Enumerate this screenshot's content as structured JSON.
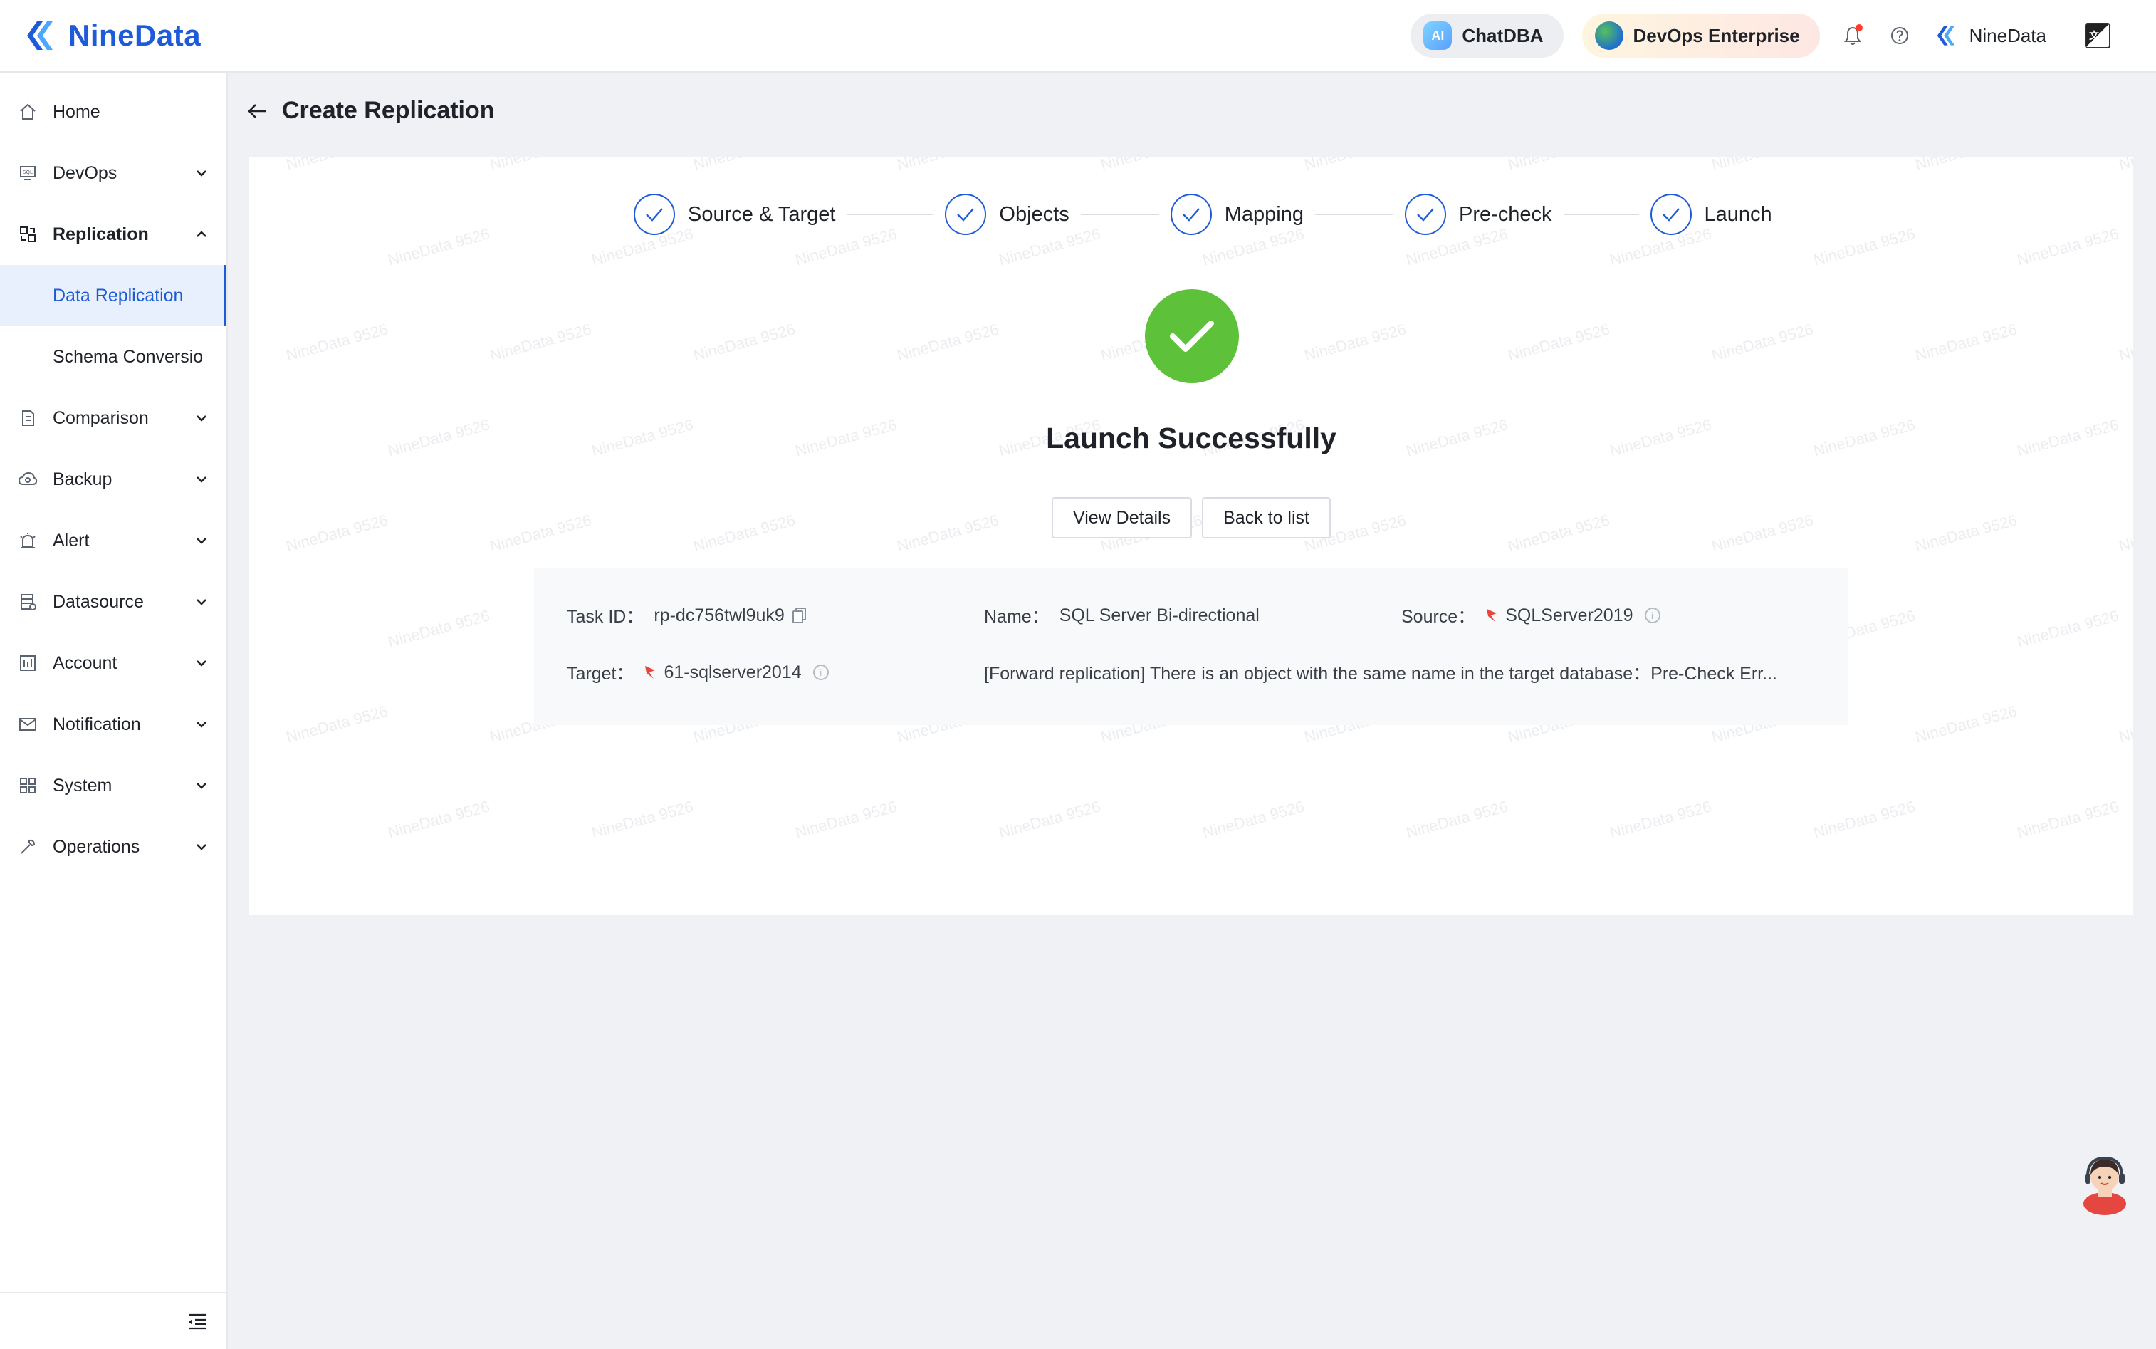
{
  "brand": {
    "name": "NineData"
  },
  "topbar": {
    "chatdba": "ChatDBA",
    "ai_badge": "AI",
    "devops": "DevOps Enterprise",
    "user": "NineData",
    "lang_badge": "文A"
  },
  "sidebar": {
    "items": [
      {
        "label": "Home",
        "icon": "home-icon",
        "expandable": false
      },
      {
        "label": "DevOps",
        "icon": "sql-console-icon",
        "expandable": true
      },
      {
        "label": "Replication",
        "icon": "replication-icon",
        "expandable": true,
        "expanded": true
      },
      {
        "label": "Comparison",
        "icon": "document-compare-icon",
        "expandable": true
      },
      {
        "label": "Backup",
        "icon": "cloud-backup-icon",
        "expandable": true
      },
      {
        "label": "Alert",
        "icon": "alarm-icon",
        "expandable": true
      },
      {
        "label": "Datasource",
        "icon": "database-icon",
        "expandable": true
      },
      {
        "label": "Account",
        "icon": "account-icon",
        "expandable": true
      },
      {
        "label": "Notification",
        "icon": "mail-icon",
        "expandable": true
      },
      {
        "label": "System",
        "icon": "grid-icon",
        "expandable": true
      },
      {
        "label": "Operations",
        "icon": "wrench-icon",
        "expandable": true
      }
    ],
    "sub_items": [
      {
        "label": "Data Replication",
        "active": true
      },
      {
        "label": "Schema Conversio",
        "active": false
      }
    ]
  },
  "page": {
    "title": "Create Replication"
  },
  "steps": [
    {
      "label": "Source & Target",
      "done": true
    },
    {
      "label": "Objects",
      "done": true
    },
    {
      "label": "Mapping",
      "done": true
    },
    {
      "label": "Pre-check",
      "done": true
    },
    {
      "label": "Launch",
      "done": true
    }
  ],
  "result": {
    "title": "Launch Successfully",
    "view_details": "View Details",
    "back_to_list": "Back to list"
  },
  "task": {
    "task_id_label": "Task ID：",
    "task_id": "rp-dc756twl9uk9",
    "name_label": "Name：",
    "name": "SQL Server Bi-directional",
    "source_label": "Source：",
    "source": "SQLServer2019",
    "target_label": "Target：",
    "target": "61-sqlserver2014",
    "message": "[Forward replication] There is an object with the same name in the target database：Pre-Check Err..."
  },
  "watermark": "NineData 9526",
  "colors": {
    "primary": "#1e5bd8",
    "success": "#5ec13a",
    "source_flag": "#e8453c"
  }
}
